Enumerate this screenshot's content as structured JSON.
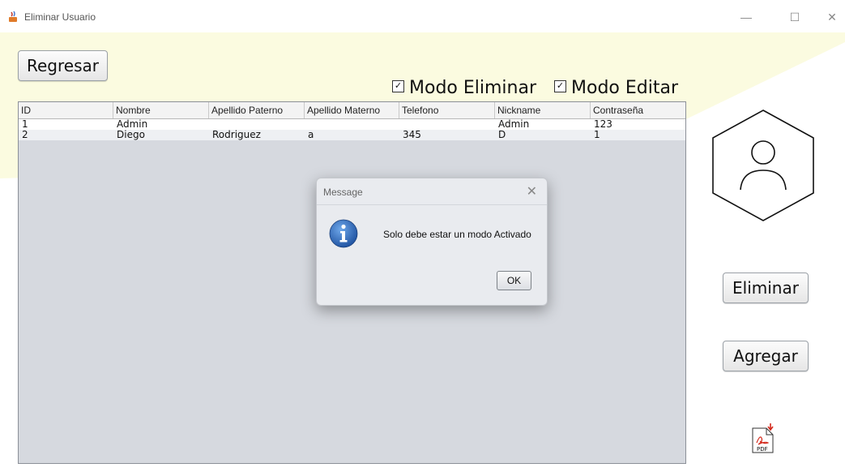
{
  "window": {
    "title": "Eliminar Usuario",
    "controls": [
      "—",
      "☐",
      "✕"
    ]
  },
  "buttons": {
    "regresar": "Regresar",
    "eliminar": "Eliminar",
    "agregar": "Agregar"
  },
  "checkboxes": {
    "modo_eliminar": {
      "label": "Modo Eliminar",
      "checked": true,
      "mark": "☑"
    },
    "modo_editar": {
      "label": "Modo Editar",
      "checked": true,
      "mark": "☑"
    }
  },
  "table": {
    "columns": [
      "ID",
      "Nombre",
      "Apellido Paterno",
      "Apellido Materno",
      "Telefono",
      "Nickname",
      "Contraseña"
    ],
    "rows": [
      [
        "1",
        "Admin",
        "",
        "",
        "",
        "Admin",
        "123"
      ],
      [
        "2",
        "Diego",
        "Rodriguez",
        "a",
        "345",
        "D",
        "1"
      ]
    ]
  },
  "dialog": {
    "title": "Message",
    "close": "✕",
    "message": "Solo debe estar un modo Activado",
    "ok": "OK"
  },
  "icons": {
    "user_avatar": "user-hexagon-icon",
    "pdf": "pdf-icon",
    "info": "info-icon"
  },
  "colors": {
    "background_accent": "#fbfbe0",
    "table_bg": "#d6d9df",
    "dialog_bg": "#e9ebef",
    "info_blue": "#2f6fc4",
    "pdf_red": "#d42b1e"
  }
}
